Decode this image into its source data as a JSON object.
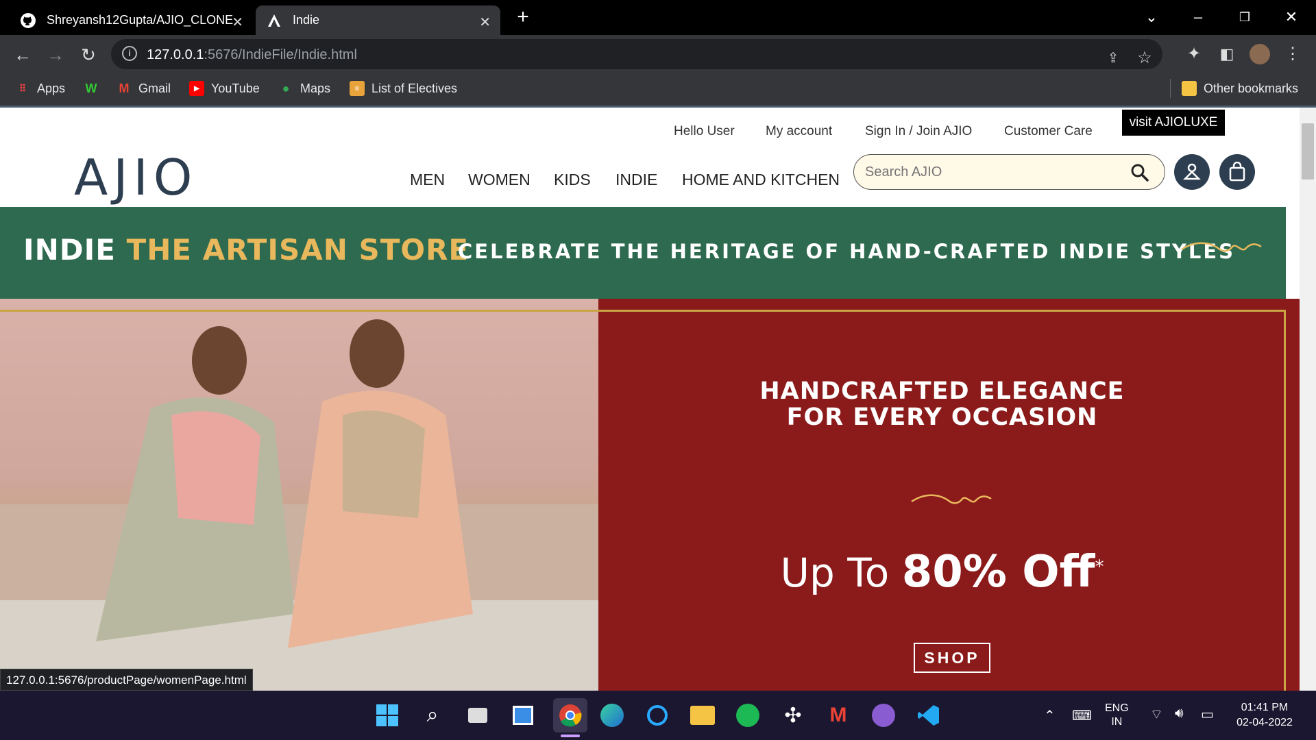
{
  "browser": {
    "tabs": [
      {
        "title": "Shreyansh12Gupta/AJIO_CLONE",
        "icon": "github-icon"
      },
      {
        "title": "Indie",
        "icon": "ajio-a-icon",
        "active": true
      }
    ],
    "url_host": "127.0.0.1",
    "url_rest": ":5676/IndieFile/Indie.html",
    "bookmarks": [
      "Apps",
      "Gmail",
      "YouTube",
      "Maps",
      "List of Electives"
    ],
    "other_bookmarks": "Other bookmarks",
    "status_url": "127.0.0.1:5676/productPage/womenPage.html"
  },
  "header": {
    "top_links": [
      "Hello User",
      "My account",
      "Sign In / Join AJIO",
      "Customer Care"
    ],
    "luxe_button": "visit AJIOLUXE",
    "logo": "AJIO",
    "nav": [
      "MEN",
      "WOMEN",
      "KIDS",
      "INDIE",
      "HOME AND KITCHEN"
    ],
    "search_placeholder": "Search AJIO"
  },
  "banner": {
    "brand": "INDIE",
    "store": "THE ARTISAN STORE",
    "tagline": "CELEBRATE THE HERITAGE OF HAND-CRAFTED INDIE STYLES",
    "color": "#2d6a4f",
    "accent": "#e9b85c"
  },
  "hero": {
    "headline_1": "HANDCRAFTED ELEGANCE",
    "headline_2": "FOR EVERY OCCASION",
    "offer_prefix": "Up To ",
    "offer_value": "80% Off",
    "offer_mark": "*",
    "shop_label": "SHOP",
    "color": "#8b1a1a"
  },
  "taskbar": {
    "lang_1": "ENG",
    "lang_2": "IN",
    "time": "01:41 PM",
    "date": "02-04-2022"
  }
}
